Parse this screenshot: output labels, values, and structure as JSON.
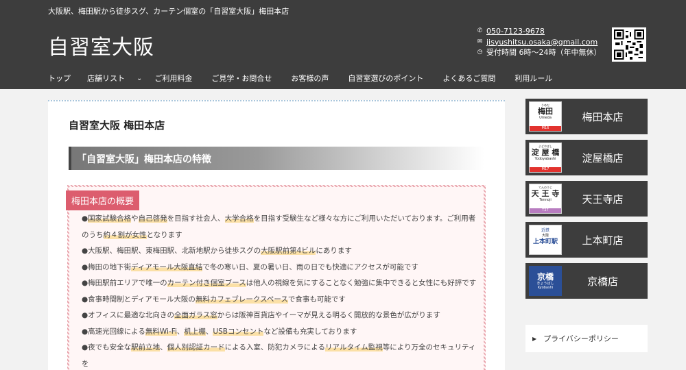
{
  "header": {
    "tagline": "大阪駅、梅田駅から徒歩スグ、カーテン個室の「自習室大阪」梅田本店",
    "site_title": "自習室大阪",
    "contact": {
      "phone": "050-7123-9678",
      "email": "jisyushitsu.osaka@gmail.com",
      "hours": "受付時間 6時〜24時（年中無休）"
    },
    "icons": {
      "phone": "phone-icon",
      "email": "mail-icon",
      "hours": "clock-icon",
      "qr": "qr-code"
    }
  },
  "nav": {
    "items": [
      "トップ",
      "店舗リスト",
      "ご利用料金",
      "ご見学・お問合せ",
      "お客様の声",
      "自習室選びのポイント",
      "よくあるご質問",
      "利用ルール"
    ],
    "chevron": "chevron-down-icon"
  },
  "main": {
    "page_title": "自習室大阪 梅田本店",
    "section_heading": "「自習室大阪」梅田本店の特徴",
    "overview_label": "梅田本店の概要",
    "bullets": [
      [
        "●",
        "国家試験合格",
        "や",
        "自己啓発",
        "を目指す社会人、",
        "大学合格",
        "を目指す受験生など様々な方にご利用いただいております。ご利用者のうち",
        "約４割が女性",
        "となります"
      ],
      [
        "●大阪駅、梅田駅、東梅田駅、北新地駅から徒歩スグの",
        "大阪駅前第4ビル",
        "にあります"
      ],
      [
        "●梅田の地下街",
        "ディアモール大阪直結",
        "で冬の寒い日、夏の暑い日、雨の日でも快適にアクセスが可能です"
      ],
      [
        "●梅田駅前エリアで唯一の",
        "カーテン付き個室ブース",
        "は他人の視線を気にすることなく勉強に集中できると女性にも好評です"
      ],
      [
        "●食事時間制とディアモール大阪の",
        "無料カフェブレークスペース",
        "で食事も可能です"
      ],
      [
        "●オフィスに最適な北向きの",
        "全面ガラス窓",
        "からは阪神百貨店やイーマが見える明るく開放的な景色が広がります"
      ],
      [
        "●高速光回線による",
        "無料Wi-Fi",
        "、",
        "机上棚",
        "、",
        "USBコンセント",
        "など設備も充実しております"
      ],
      [
        "●夜でも安全な",
        "駅前立地",
        "、",
        "個人別認証カード",
        "による入室、防犯カメラによる",
        "リアルタイム監視",
        "等により万全のセキュリティを"
      ]
    ]
  },
  "sidebar": {
    "stores": [
      {
        "sign_kana": "うめだ",
        "sign_kanji": "梅田",
        "sign_roma": "Umeda",
        "sign_code": "M16",
        "name": "梅田本店",
        "color": "#e2322e"
      },
      {
        "sign_kana": "よどやばし",
        "sign_kanji": "淀 屋 橋",
        "sign_roma": "Yodoyabashi",
        "sign_code": "M17",
        "name": "淀屋橋店",
        "color": "#e2322e"
      },
      {
        "sign_kana": "てんのうじ",
        "sign_kanji": "天 王 寺",
        "sign_roma": "Tennoji",
        "sign_code": "T27",
        "name": "天王寺店",
        "color": "#b87cc0"
      },
      {
        "sign_kana": "近鉄",
        "sign_kanji": "上本町駅",
        "sign_roma": "大阪",
        "sign_code": "",
        "name": "上本町店",
        "color": "#2b4f97"
      },
      {
        "sign_kana": "きょうばし",
        "sign_kanji": "京橋",
        "sign_roma": "Kyobashi",
        "sign_code": "",
        "name": "京橋店",
        "color": "#2b4f97"
      }
    ],
    "privacy": "プライバシーポリシー"
  }
}
